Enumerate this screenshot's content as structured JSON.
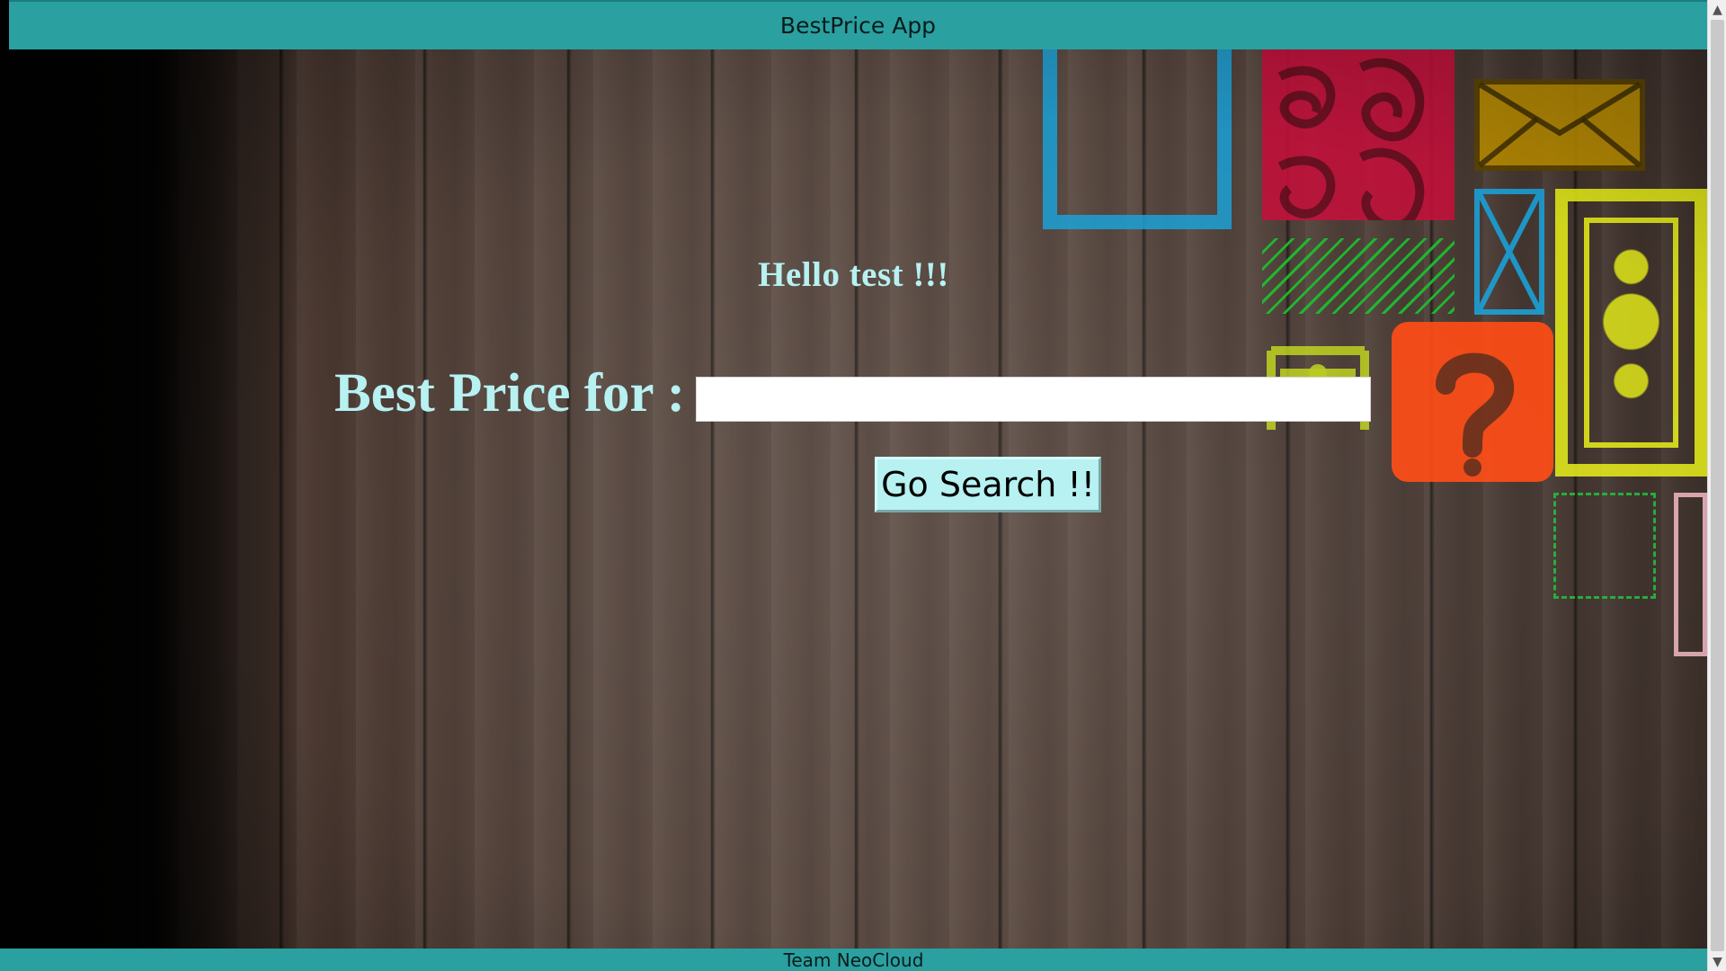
{
  "app": {
    "title": "BestPrice App",
    "footer": "Team NeoCloud"
  },
  "main": {
    "greeting": "Hello test !!!",
    "search_label": "Best Price for :",
    "search_value": "",
    "search_placeholder": "",
    "search_button": "Go Search !!"
  },
  "icons": {
    "scroll_up": "scroll-up-arrow-icon",
    "scroll_down": "scroll-down-arrow-icon"
  },
  "colors": {
    "bar": "#2aa0a0",
    "accent_text": "#b7f1f2"
  }
}
